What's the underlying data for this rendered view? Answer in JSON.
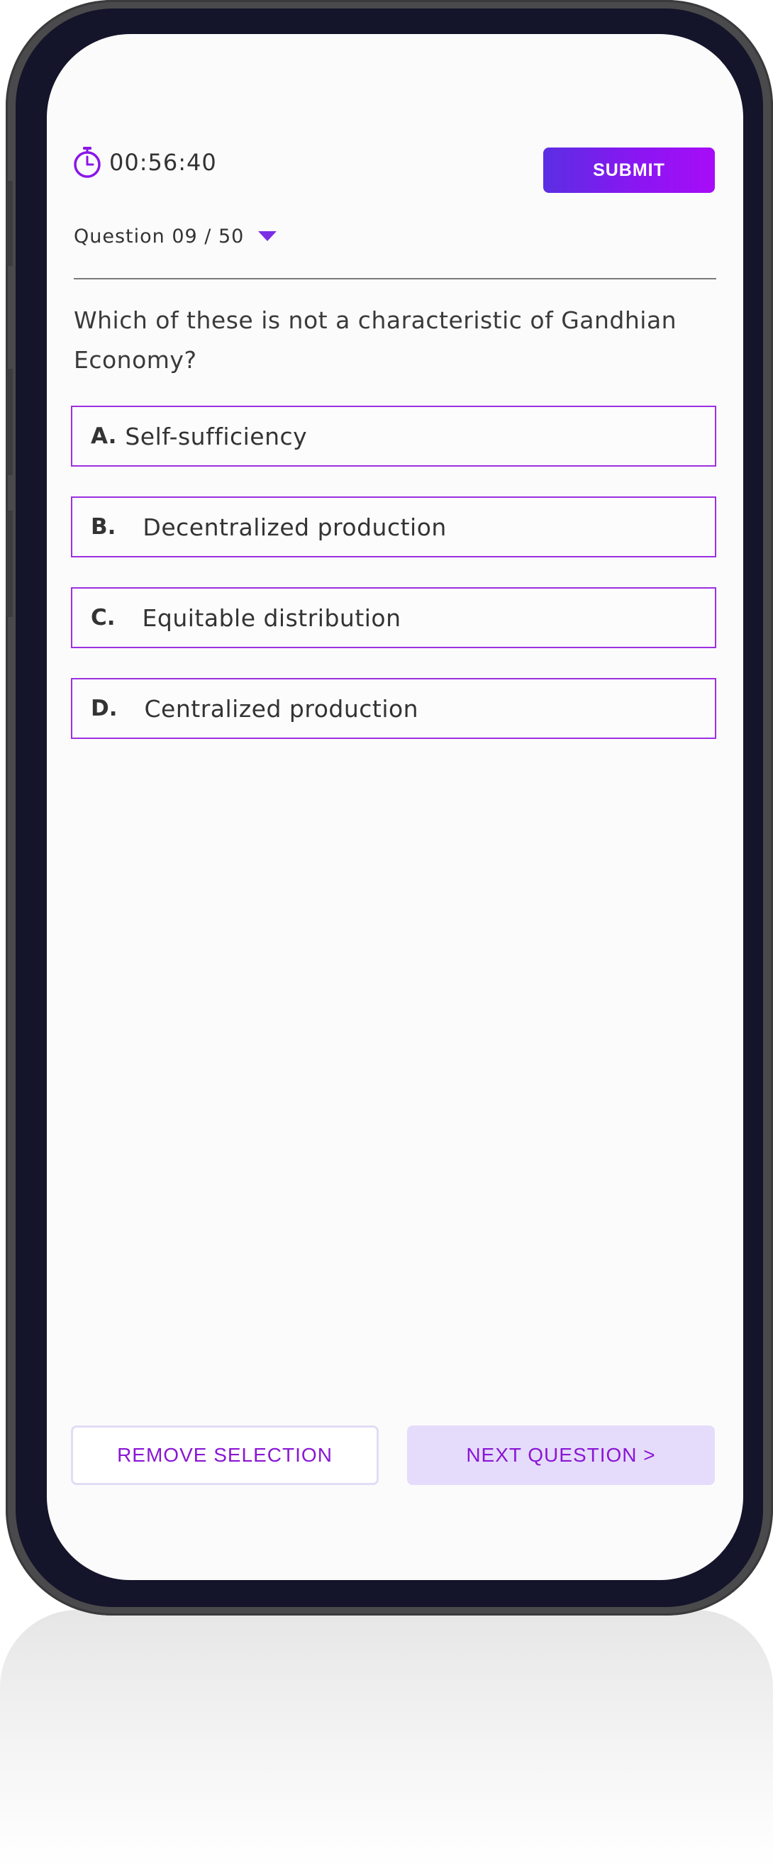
{
  "header": {
    "timer": "00:56:40",
    "submit_label": "SUBMIT",
    "question_counter": "Question 09 / 50"
  },
  "question": {
    "text": "Which of these is not a characteristic of Gandhian Economy?",
    "options": [
      {
        "letter": "A.",
        "text": "Self-sufficiency"
      },
      {
        "letter": "B.",
        "text": "Decentralized production"
      },
      {
        "letter": "C.",
        "text": "Equitable distribution"
      },
      {
        "letter": "D.",
        "text": "Centralized production"
      }
    ]
  },
  "footer": {
    "remove_label": "REMOVE SELECTION",
    "next_label": "NEXT QUESTION >"
  },
  "icons": {
    "timer": "stopwatch-icon",
    "dropdown": "caret-down-icon"
  },
  "colors": {
    "accent": "#9b30e0",
    "submit_gradient_start": "#5b2ee3",
    "submit_gradient_end": "#a80cf7",
    "next_bg": "#e5dcfb",
    "button_text": "#8a16d4"
  }
}
